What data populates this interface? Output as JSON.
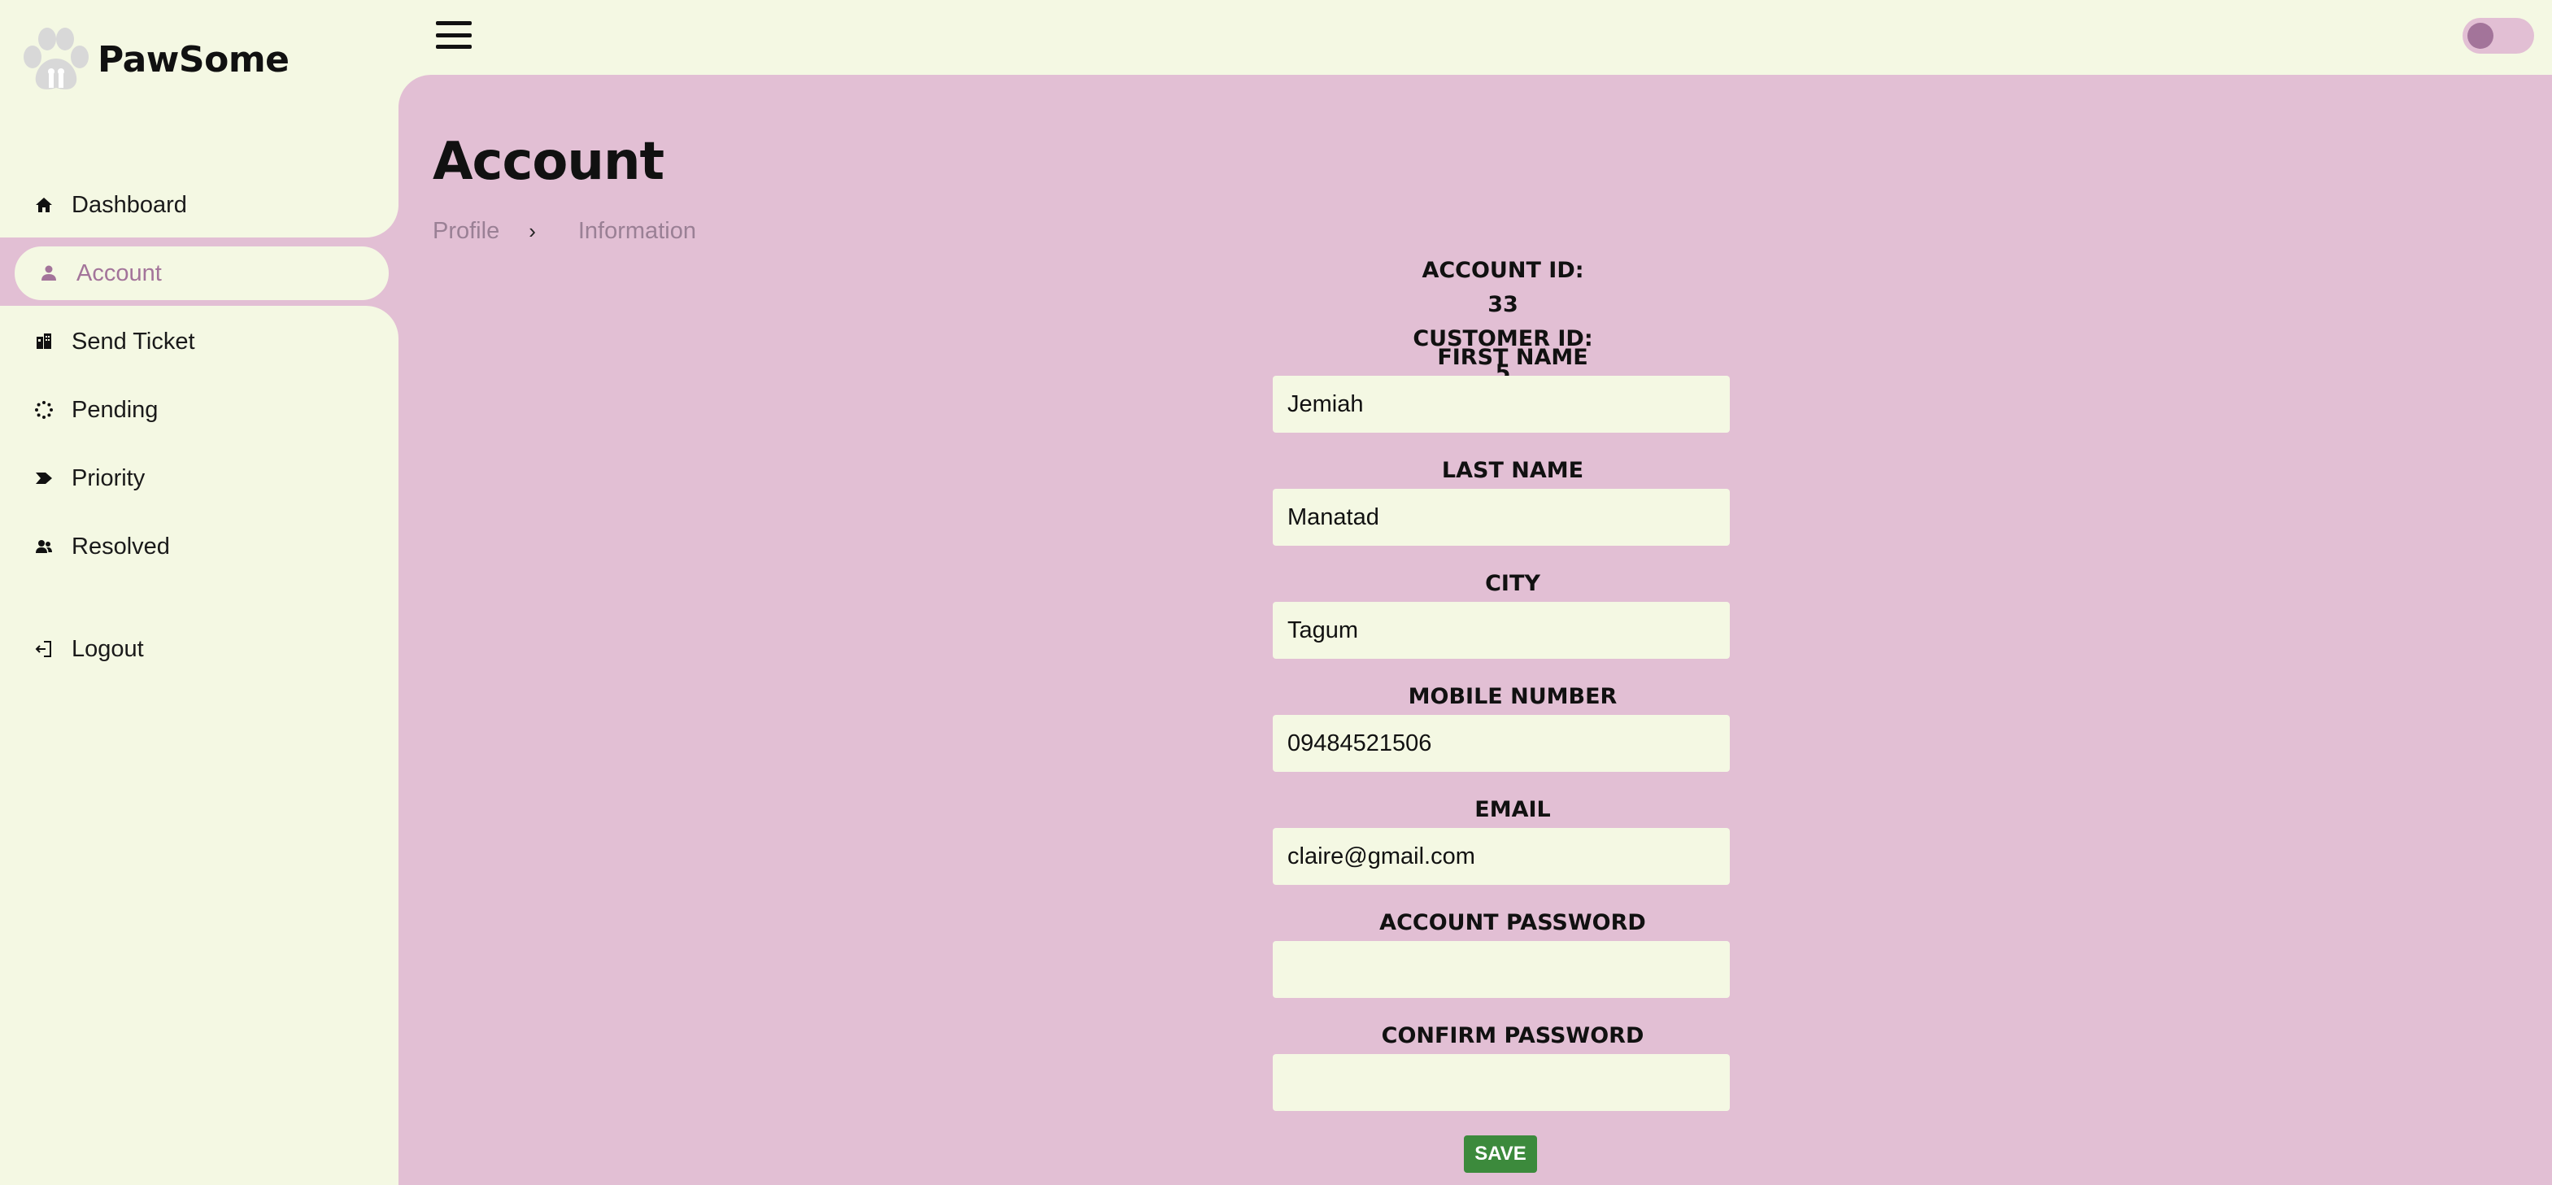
{
  "brand": {
    "name": "PawSome",
    "logo_icon": "paw-icon"
  },
  "sidebar": {
    "items": [
      {
        "label": "Dashboard",
        "icon": "home-icon"
      },
      {
        "label": "Account",
        "icon": "user-icon",
        "active": true
      },
      {
        "label": "Send Ticket",
        "icon": "ticket-icon"
      },
      {
        "label": "Pending",
        "icon": "spinner-icon"
      },
      {
        "label": "Priority",
        "icon": "tag-icon"
      },
      {
        "label": "Resolved",
        "icon": "users-icon"
      },
      {
        "label": "Logout",
        "icon": "logout-icon"
      }
    ]
  },
  "header": {
    "menu_icon": "hamburger-icon",
    "theme_toggle": "off"
  },
  "page": {
    "title": "Account",
    "breadcrumb": [
      "Profile",
      "Information"
    ],
    "breadcrumb_separator": "›"
  },
  "account": {
    "account_id": "ACCOUNT ID: 33",
    "customer_id": "CUSTOMER ID: 5"
  },
  "form": {
    "fields": [
      {
        "label": "FIRST NAME",
        "value": "Jemiah"
      },
      {
        "label": "LAST NAME",
        "value": "Manatad"
      },
      {
        "label": "CITY",
        "value": "Tagum"
      },
      {
        "label": "MOBILE NUMBER",
        "value": "09484521506"
      },
      {
        "label": "EMAIL",
        "value": "claire@gmail.com"
      },
      {
        "label": "ACCOUNT PASSWORD",
        "value": ""
      },
      {
        "label": "CONFIRM PASSWORD",
        "value": ""
      }
    ],
    "save_label": "SAVE"
  },
  "colors": {
    "background": "#f4f8e3",
    "panel": "#e2bfd4",
    "accent": "#a3749a",
    "save": "#3c8a3c"
  }
}
